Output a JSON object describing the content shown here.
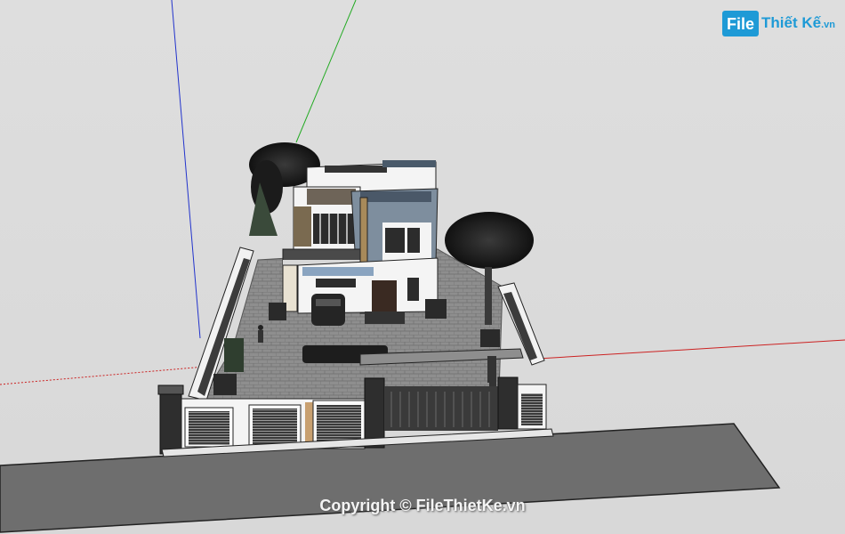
{
  "logo": {
    "box": "File",
    "name": "Thiết Kế",
    "tld": ".vn",
    "box_color": "#1e9ad6"
  },
  "copyright": "Copyright © FileThietKe.vn",
  "axes": {
    "blue": "#2233cc",
    "green": "#22aa22",
    "red": "#cc2222"
  },
  "colors": {
    "background": "#dcdcdc",
    "road": "#6e6e6e",
    "paving": "#8c8c8c",
    "wall": "#ffffff"
  }
}
